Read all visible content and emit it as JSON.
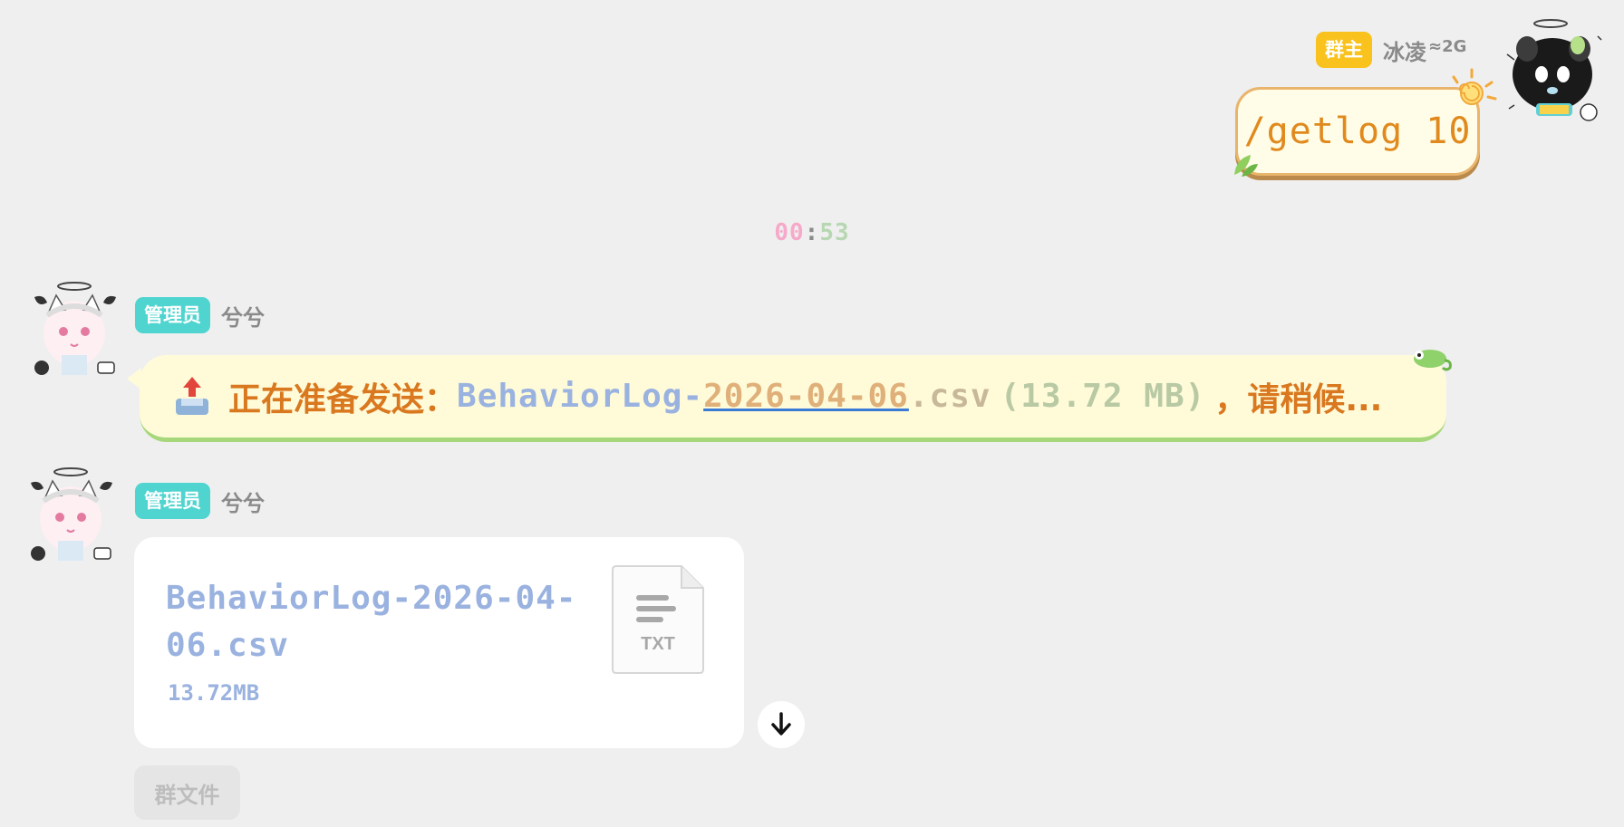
{
  "owner_message": {
    "badge": "群主",
    "sender": "冰凌",
    "network": "2G",
    "command": "/getlog 10"
  },
  "time_divider": {
    "h": "00",
    "sep": ":",
    "m": "53"
  },
  "admin_message_1": {
    "badge": "管理员",
    "sender": "兮兮",
    "status_prefix": "正在准备发送：",
    "filename_plain": "BehaviorLog-",
    "filename_date": "2026-04-06",
    "filename_ext": ".csv",
    "size_text": "(13.72 MB)",
    "status_suffix": "，请稍候..."
  },
  "admin_message_2": {
    "badge": "管理员",
    "sender": "兮兮",
    "file": {
      "name": "BehaviorLog-2026-04-06.csv",
      "size": "13.72MB",
      "type_label": "TXT"
    },
    "group_file_label": "群文件"
  },
  "colors": {
    "owner_badge": "#f9c21c",
    "admin_badge": "#4fd4d0",
    "command_text": "#e08a1e",
    "status_text": "#d9781e",
    "link_underline": "#3a7bd5"
  }
}
